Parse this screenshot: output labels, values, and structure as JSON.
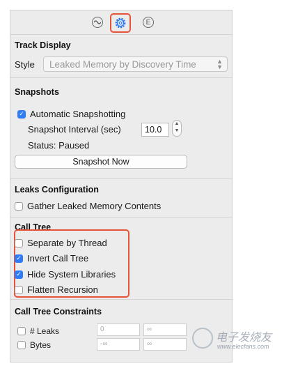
{
  "toolbar": {
    "icons": [
      "waveform-icon",
      "gear-icon",
      "extended-info-icon"
    ],
    "info_glyph": "E",
    "highlight_color": "#e5533a"
  },
  "track_display": {
    "title": "Track Display",
    "style_label": "Style",
    "style_value": "Leaked Memory by Discovery Time"
  },
  "snapshots": {
    "title": "Snapshots",
    "auto_label": "Automatic Snapshotting",
    "auto_checked": true,
    "interval_label": "Snapshot Interval (sec)",
    "interval_value": "10.0",
    "status_text": "Status:  Paused",
    "snapshot_button": "Snapshot Now"
  },
  "leaks_config": {
    "title": "Leaks Configuration",
    "gather_label": "Gather Leaked Memory Contents",
    "gather_checked": false
  },
  "call_tree": {
    "title": "Call Tree",
    "options": [
      {
        "label": "Separate by Thread",
        "checked": false
      },
      {
        "label": "Invert Call Tree",
        "checked": true
      },
      {
        "label": "Hide System Libraries",
        "checked": true
      },
      {
        "label": "Flatten Recursion",
        "checked": false
      }
    ]
  },
  "constraints": {
    "title": "Call Tree Constraints",
    "rows": [
      {
        "label": "# Leaks",
        "min": "0",
        "max": "∞"
      },
      {
        "label": "Bytes",
        "min": "-∞",
        "max": "∞"
      }
    ]
  },
  "watermark": {
    "text": "电子发烧友",
    "url": "www.elecfans.com"
  },
  "colors": {
    "accent": "#2f7cf6",
    "highlight": "#e5533a",
    "panel": "#ececec"
  }
}
